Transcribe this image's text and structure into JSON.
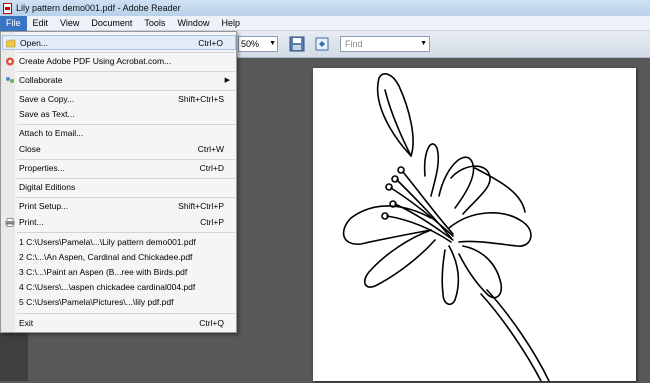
{
  "window": {
    "title": "Lily pattern demo001.pdf - Adobe Reader"
  },
  "menubar": {
    "items": [
      "File",
      "Edit",
      "View",
      "Document",
      "Tools",
      "Window",
      "Help"
    ]
  },
  "toolbar": {
    "zoom_value": "50%",
    "find_placeholder": "Find"
  },
  "file_menu": {
    "open": {
      "label": "Open...",
      "shortcut": "Ctrl+O"
    },
    "create_pdf": {
      "label": "Create Adobe PDF Using Acrobat.com..."
    },
    "collaborate": {
      "label": "Collaborate"
    },
    "save_copy": {
      "label": "Save a Copy...",
      "shortcut": "Shift+Ctrl+S"
    },
    "save_text": {
      "label": "Save as Text..."
    },
    "attach_email": {
      "label": "Attach to Email..."
    },
    "close": {
      "label": "Close",
      "shortcut": "Ctrl+W"
    },
    "properties": {
      "label": "Properties...",
      "shortcut": "Ctrl+D"
    },
    "digital_editions": {
      "label": "Digital Editions"
    },
    "print_setup": {
      "label": "Print Setup...",
      "shortcut": "Shift+Ctrl+P"
    },
    "print": {
      "label": "Print...",
      "shortcut": "Ctrl+P"
    },
    "recent": [
      "1 C:\\Users\\Pamela\\...\\Lily pattern demo001.pdf",
      "2 C:\\...\\An Aspen, Cardinal and Chickadee.pdf",
      "3 C:\\...\\Paint an Aspen (B...ree with Birds.pdf",
      "4 C:\\Users\\...\\aspen chickadee cardinal004.pdf",
      "5 C:\\Users\\Pamela\\Pictures\\...\\lily pdf.pdf"
    ],
    "exit": {
      "label": "Exit",
      "shortcut": "Ctrl+Q"
    }
  },
  "colors": {
    "menu_highlight": "#e3edf9",
    "active_menu": "#3a75c4"
  },
  "icons": [
    "pdf-file-icon",
    "folder-open-icon",
    "acrobat-com-icon",
    "collaborate-icon",
    "printer-icon",
    "save-icon",
    "fit-page-icon"
  ]
}
